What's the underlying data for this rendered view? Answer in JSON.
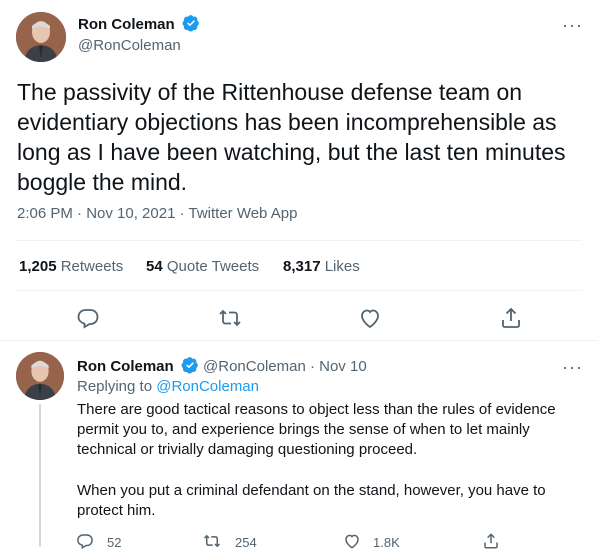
{
  "main_tweet": {
    "author_name": "Ron Coleman",
    "handle": "@RonColeman",
    "text": "The passivity of the Rittenhouse defense team on evidentiary objections has been incomprehensible as long as I have been watching, but the last ten minutes boggle the mind.",
    "meta": "2:06 PM · Nov 10, 2021 · Twitter Web App",
    "stats": {
      "retweets_count": "1,205",
      "retweets_label": "Retweets",
      "quotes_count": "54",
      "quotes_label": "Quote Tweets",
      "likes_count": "8,317",
      "likes_label": "Likes"
    },
    "more_label": "···"
  },
  "reply_tweet": {
    "author_name": "Ron Coleman",
    "handle_date": "@RonColeman · Nov 10",
    "replying_prefix": "Replying to",
    "replying_handle": "@RonColeman",
    "paragraph1": "There are good tactical reasons to object less than the rules of evidence permit you to, and experience brings the sense of when to let mainly technical or trivially damaging questioning proceed.",
    "paragraph2": "When you put a criminal defendant on the stand, however, you have to protect him.",
    "reply_count": "52",
    "retweet_count": "254",
    "like_count": "1.8K",
    "more_label": "···"
  },
  "colors": {
    "verified": "#1d9bf0",
    "link": "#1d9bf0",
    "muted": "#536471"
  },
  "icons": [
    "verified-badge-icon",
    "more-icon",
    "reply-icon",
    "retweet-icon",
    "like-icon",
    "share-icon"
  ]
}
